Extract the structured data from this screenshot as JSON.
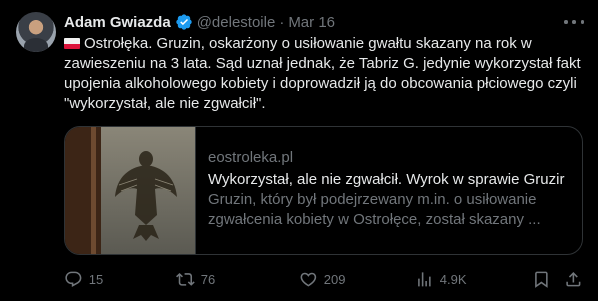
{
  "author": {
    "name": "Adam Gwiazda",
    "handle": "@delestoile",
    "separator": "·",
    "date": "Mar 16"
  },
  "tweet": {
    "line1": "Ostrołęka. Gruzin, oskarżony o usiłowanie gwałtu skazany na rok w zawieszeniu na 3 lata. Sąd uznał jednak, że Tabriz G. jedynie wykorzystał fakt upojenia alkoholowego kobiety i doprowadził ją do obcowania płciowego czyli \"wykorzystał, ale nie zgwałcił\"."
  },
  "link_card": {
    "domain": "eostroleka.pl",
    "title": "Wykorzystał, ale nie zgwałcił. Wyrok w sprawie Gruzir",
    "description": "Gruzin, który był podejrzewany m.in. o usiłowanie zgwałcenia kobiety w Ostrołęce, został skazany ..."
  },
  "actions": {
    "replies": "15",
    "retweets": "76",
    "likes": "209",
    "views": "4.9K"
  },
  "icons": [
    "verified-badge-icon",
    "more-icon",
    "poland-flag-icon",
    "reply-icon",
    "retweet-icon",
    "like-icon",
    "views-icon",
    "bookmark-icon",
    "share-icon"
  ],
  "colors": {
    "background": "#000000",
    "text": "#e7e9ea",
    "muted": "#71767b",
    "verified": "#1d9bf0",
    "border": "#2f3336"
  }
}
